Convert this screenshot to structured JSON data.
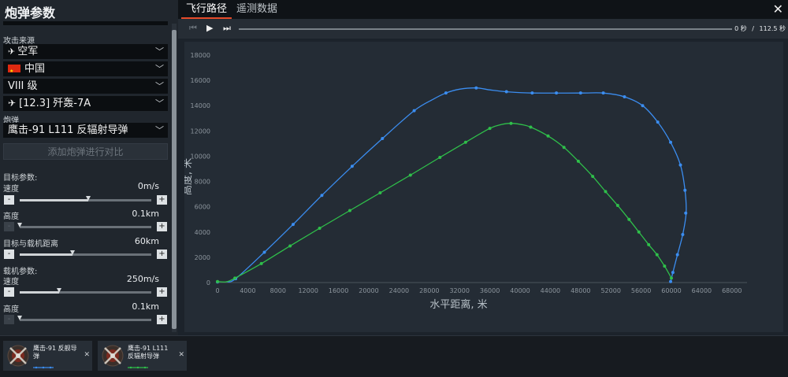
{
  "panel": {
    "title": "炮弹参数",
    "attack_source_label": "攻击来源",
    "service": "空军",
    "country": "中国",
    "rank": "VIII 级",
    "aircraft": "[12.3] 歼轰-7A",
    "shell_label": "炮弹",
    "shell": "鹰击-91 L111 反辐射导弹",
    "compare_button": "添加炮弹进行对比",
    "target_params_label": "目标参数:",
    "target_speed_label": "速度",
    "target_speed_value": "0m/s",
    "target_speed_level": 0.52,
    "target_alt_label": "高度",
    "target_alt_value": "0.1km",
    "target_alt_level": 0.0,
    "distance_label": "目标与载机距离",
    "distance_value": "60km",
    "distance_level": 0.4,
    "carrier_params_label": "载机参数:",
    "carrier_speed_label": "速度",
    "carrier_speed_value": "250m/s",
    "carrier_speed_level": 0.3,
    "carrier_alt_label": "高度",
    "carrier_alt_value": "0.1km",
    "carrier_alt_level": 0.0,
    "minus": "-",
    "plus": "+"
  },
  "tabs": [
    "飞行路径",
    "遥测数据"
  ],
  "close_icon": "close-icon",
  "playback": {
    "time_current": "0 秒",
    "separator": "/",
    "time_total": "112.5 秒"
  },
  "weapons": [
    {
      "name": "鹰击-91 反舰导弹",
      "color": "#3b8df0",
      "icon": "missile-icon"
    },
    {
      "name": "鹰击-91 L111 反辐射导弹",
      "color": "#2fbf4a",
      "icon": "missile-icon"
    }
  ],
  "colors": {
    "accent": "#e64b2a",
    "series_blue": "#3b8df0",
    "series_green": "#2fbf4a"
  },
  "chart_data": {
    "type": "line",
    "xlabel": "水平距离, 米",
    "ylabel": "高度, 米",
    "xlim": [
      0,
      70000
    ],
    "ylim": [
      0,
      18000
    ],
    "xticks": [
      0,
      4000,
      8000,
      12000,
      16000,
      20000,
      24000,
      28000,
      32000,
      36000,
      40000,
      44000,
      48000,
      52000,
      56000,
      60000,
      64000,
      68000
    ],
    "yticks": [
      0,
      2000,
      4000,
      6000,
      8000,
      10000,
      12000,
      14000,
      16000,
      18000
    ],
    "grid": false,
    "series": [
      {
        "color": "#3b8df0",
        "points": [
          [
            0,
            50
          ],
          [
            2400,
            300
          ],
          [
            6200,
            2400
          ],
          [
            10000,
            4600
          ],
          [
            13800,
            6900
          ],
          [
            17800,
            9200
          ],
          [
            21800,
            11400
          ],
          [
            26000,
            13600
          ],
          [
            30200,
            15000
          ],
          [
            34200,
            15400
          ],
          [
            38200,
            15100
          ],
          [
            41600,
            15000
          ],
          [
            44800,
            15000
          ],
          [
            48000,
            15000
          ],
          [
            51000,
            15000
          ],
          [
            53800,
            14700
          ],
          [
            56200,
            14000
          ],
          [
            58200,
            12700
          ],
          [
            59900,
            11100
          ],
          [
            61200,
            9300
          ],
          [
            61800,
            7300
          ],
          [
            61900,
            5500
          ],
          [
            61500,
            3800
          ],
          [
            60800,
            2200
          ],
          [
            60200,
            800
          ],
          [
            59900,
            80
          ]
        ],
        "smooth_points": [
          [
            1200,
            60
          ],
          [
            2400,
            300
          ],
          [
            6200,
            2400
          ],
          [
            10000,
            4600
          ],
          [
            13800,
            6900
          ],
          [
            17800,
            9200
          ],
          [
            21800,
            11400
          ],
          [
            26000,
            13600
          ],
          [
            28500,
            14500
          ],
          [
            30200,
            15000
          ],
          [
            32000,
            15300
          ],
          [
            34200,
            15400
          ],
          [
            36000,
            15250
          ],
          [
            38200,
            15100
          ],
          [
            41600,
            15000
          ],
          [
            48000,
            15000
          ],
          [
            51000,
            15000
          ],
          [
            53800,
            14700
          ],
          [
            56200,
            14000
          ],
          [
            58200,
            12700
          ],
          [
            59900,
            11100
          ],
          [
            61200,
            9300
          ],
          [
            61800,
            7300
          ],
          [
            61950,
            5500
          ],
          [
            61500,
            3800
          ],
          [
            60800,
            2200
          ],
          [
            60200,
            800
          ],
          [
            59900,
            80
          ]
        ]
      },
      {
        "color": "#2fbf4a",
        "points": [
          [
            0,
            80
          ],
          [
            2300,
            350
          ],
          [
            5800,
            1500
          ],
          [
            9600,
            2900
          ],
          [
            13500,
            4300
          ],
          [
            17500,
            5700
          ],
          [
            21500,
            7100
          ],
          [
            25500,
            8500
          ],
          [
            29400,
            9900
          ],
          [
            32800,
            11100
          ],
          [
            36000,
            12200
          ],
          [
            38800,
            12600
          ],
          [
            41400,
            12300
          ],
          [
            43700,
            11600
          ],
          [
            45800,
            10700
          ],
          [
            47700,
            9600
          ],
          [
            49600,
            8400
          ],
          [
            51300,
            7200
          ],
          [
            52900,
            6100
          ],
          [
            54400,
            5000
          ],
          [
            55700,
            4000
          ],
          [
            57000,
            3000
          ],
          [
            58100,
            2200
          ],
          [
            59100,
            1300
          ],
          [
            60000,
            350
          ]
        ],
        "smooth_points": [
          [
            0,
            80
          ],
          [
            1200,
            60
          ],
          [
            2300,
            350
          ],
          [
            5800,
            1500
          ],
          [
            9600,
            2900
          ],
          [
            13500,
            4300
          ],
          [
            17500,
            5700
          ],
          [
            21500,
            7100
          ],
          [
            25500,
            8500
          ],
          [
            29400,
            9900
          ],
          [
            32800,
            11100
          ],
          [
            36000,
            12200
          ],
          [
            37500,
            12500
          ],
          [
            38800,
            12600
          ],
          [
            40200,
            12500
          ],
          [
            41400,
            12300
          ],
          [
            43700,
            11600
          ],
          [
            45800,
            10700
          ],
          [
            47700,
            9600
          ],
          [
            49600,
            8400
          ],
          [
            51300,
            7200
          ],
          [
            52900,
            6100
          ],
          [
            54400,
            5000
          ],
          [
            55700,
            4000
          ],
          [
            57000,
            3000
          ],
          [
            58100,
            2200
          ],
          [
            59100,
            1300
          ],
          [
            60000,
            350
          ]
        ]
      }
    ]
  }
}
